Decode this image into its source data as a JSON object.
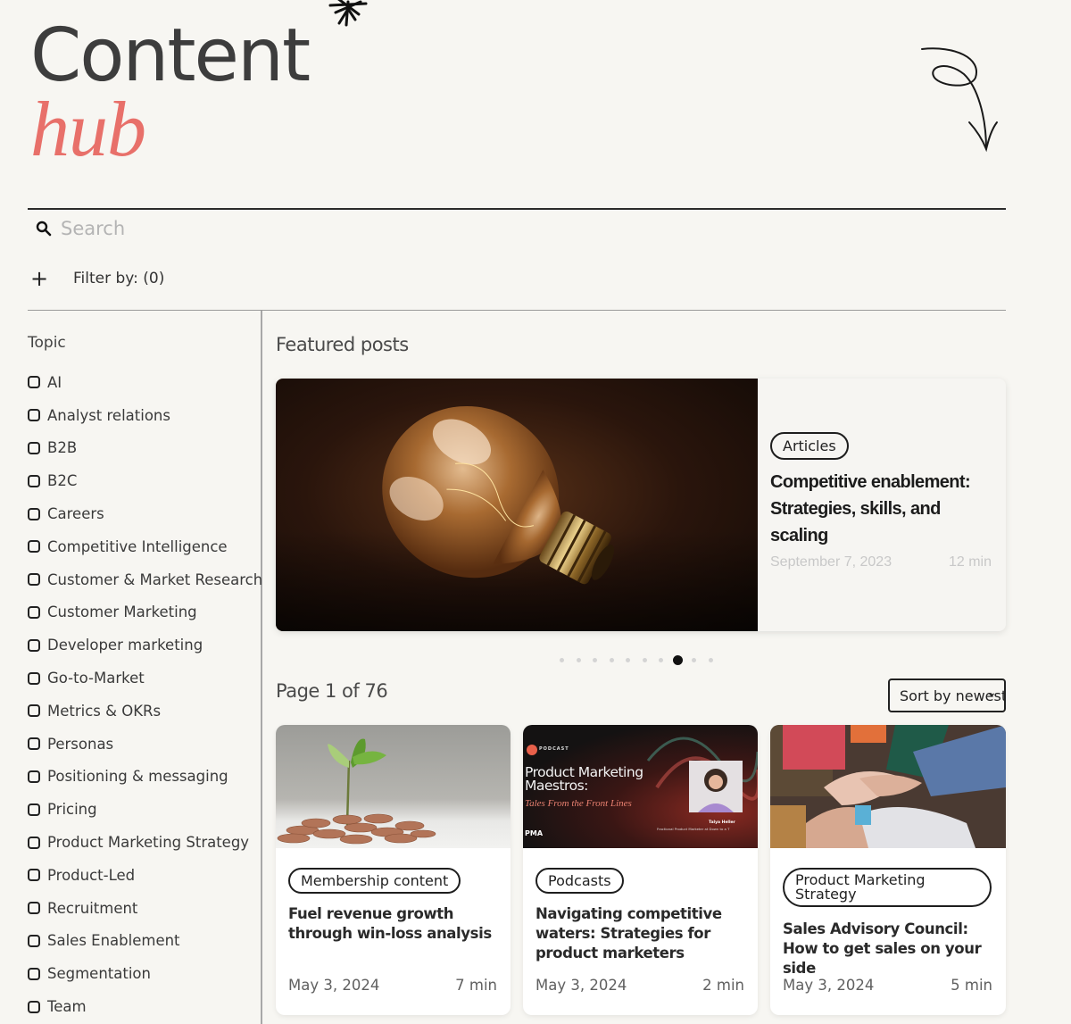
{
  "hero": {
    "title_line1": "Content",
    "title_line2": "hub"
  },
  "colors": {
    "accent": "#e8706a",
    "text_dark": "#3d3d3d",
    "background": "#f7f6f2"
  },
  "search": {
    "placeholder": "Search",
    "value": ""
  },
  "filter": {
    "label": "Filter by: (0)",
    "add_icon": "plus-icon"
  },
  "sidebar": {
    "heading": "Topic",
    "topics": [
      {
        "label": "AI",
        "checked": false
      },
      {
        "label": "Analyst relations",
        "checked": false
      },
      {
        "label": "B2B",
        "checked": false
      },
      {
        "label": "B2C",
        "checked": false
      },
      {
        "label": "Careers",
        "checked": false
      },
      {
        "label": "Competitive Intelligence",
        "checked": false
      },
      {
        "label": "Customer & Market Research",
        "checked": false
      },
      {
        "label": "Customer Marketing",
        "checked": false
      },
      {
        "label": "Developer marketing",
        "checked": false
      },
      {
        "label": "Go-to-Market",
        "checked": false
      },
      {
        "label": "Metrics & OKRs",
        "checked": false
      },
      {
        "label": "Personas",
        "checked": false
      },
      {
        "label": "Positioning & messaging",
        "checked": false
      },
      {
        "label": "Pricing",
        "checked": false
      },
      {
        "label": "Product Marketing Strategy",
        "checked": false
      },
      {
        "label": "Product-Led",
        "checked": false
      },
      {
        "label": "Recruitment",
        "checked": false
      },
      {
        "label": "Sales Enablement",
        "checked": false
      },
      {
        "label": "Segmentation",
        "checked": false
      },
      {
        "label": "Team",
        "checked": false
      }
    ]
  },
  "featured": {
    "heading": "Featured posts",
    "post": {
      "category": "Articles",
      "title": "Competitive enablement: Strategies, skills, and scaling",
      "date": "September 7, 2023",
      "read_time": "12 min",
      "image": "light-bulb-photo"
    },
    "carousel": {
      "total_slides": 10,
      "active_index": 7
    }
  },
  "listing": {
    "page_label": "Page 1 of 76",
    "sort_label": "Sort by newest",
    "cards": [
      {
        "category": "Membership content",
        "title": "Fuel revenue growth through win-loss analysis",
        "date": "May 3, 2024",
        "read_time": "7 min",
        "image": "seedling-coins-photo"
      },
      {
        "category": "Podcasts",
        "title": "Navigating competitive waters: Strategies for product marketers",
        "date": "May 3, 2024",
        "read_time": "2 min",
        "image": "podcast-cover",
        "image_text": {
          "badge": "PODCAST",
          "show_title": "Product Marketing Maestros:",
          "show_subtitle": "Tales From the Front Lines",
          "guest_name": "Talya Heller",
          "guest_role": "Fractional Product Marketer at Down to a T",
          "brand": "PMA"
        }
      },
      {
        "category": "Product Marketing Strategy",
        "title": "Sales Advisory Council: How to get sales on your side",
        "date": "May 3, 2024",
        "read_time": "5 min",
        "image": "team-hands-photo"
      }
    ]
  }
}
